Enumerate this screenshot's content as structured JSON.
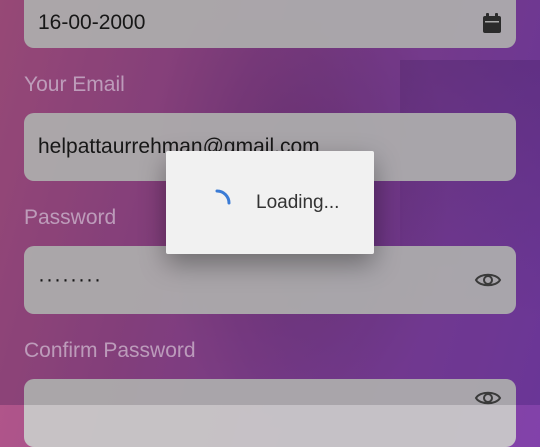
{
  "form": {
    "dob": {
      "value": "16-00-2000",
      "icon": "calendar-icon"
    },
    "email": {
      "label": "Your Email",
      "value": "helpattaurrehman@gmail.com"
    },
    "password": {
      "label": "Password",
      "value": "········",
      "icon": "eye-icon"
    },
    "confirm_password": {
      "label": "Confirm Password",
      "value": "",
      "icon": "eye-icon"
    }
  },
  "dialog": {
    "text": "Loading..."
  },
  "colors": {
    "field_bg": "#c8c8c8",
    "label": "#e6c8e6",
    "spinner": "#3a7bd5",
    "dialog_bg": "#f1f1f1"
  }
}
